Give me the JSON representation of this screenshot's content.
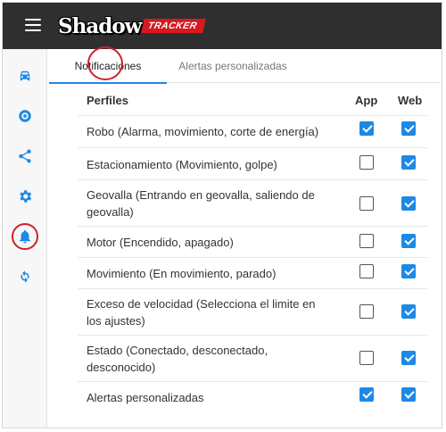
{
  "header": {
    "menu_icon": "hamburger-icon",
    "logo_main": "Shadow",
    "logo_sub": "TRACKER"
  },
  "sidebar": {
    "items": [
      {
        "icon": "car-icon",
        "name": "vehicle"
      },
      {
        "icon": "target-icon",
        "name": "location"
      },
      {
        "icon": "share-icon",
        "name": "share"
      },
      {
        "icon": "gear-icon",
        "name": "settings"
      },
      {
        "icon": "bell-icon",
        "name": "notifications",
        "active": true
      },
      {
        "icon": "refresh-icon",
        "name": "refresh"
      }
    ]
  },
  "tabs": [
    {
      "label": "Notificaciones",
      "active": true
    },
    {
      "label": "Alertas personalizadas",
      "active": false
    }
  ],
  "table": {
    "headers": {
      "profiles": "Perfiles",
      "app": "App",
      "web": "Web"
    },
    "rows": [
      {
        "label": "Robo (Alarma, movimiento, corte de energía)",
        "app": true,
        "web": true
      },
      {
        "label": "Estacionamiento (Movimiento, golpe)",
        "app": false,
        "web": true
      },
      {
        "label": "Geovalla (Entrando en geovalla, saliendo de geovalla)",
        "app": false,
        "web": true
      },
      {
        "label": "Motor (Encendido, apagado)",
        "app": false,
        "web": true
      },
      {
        "label": "Movimiento (En movimiento, parado)",
        "app": false,
        "web": true
      },
      {
        "label": "Exceso de velocidad (Selecciona el limite en los ajustes)",
        "app": false,
        "web": true
      },
      {
        "label": "Estado (Conectado, desconectado, desconocido)",
        "app": false,
        "web": true
      },
      {
        "label": "Alertas personalizadas",
        "app": true,
        "web": true
      }
    ]
  },
  "colors": {
    "accent": "#1e88e5",
    "topbar": "#2f2f2f",
    "brand_red": "#d71920",
    "highlight_ring": "#d0202a"
  }
}
